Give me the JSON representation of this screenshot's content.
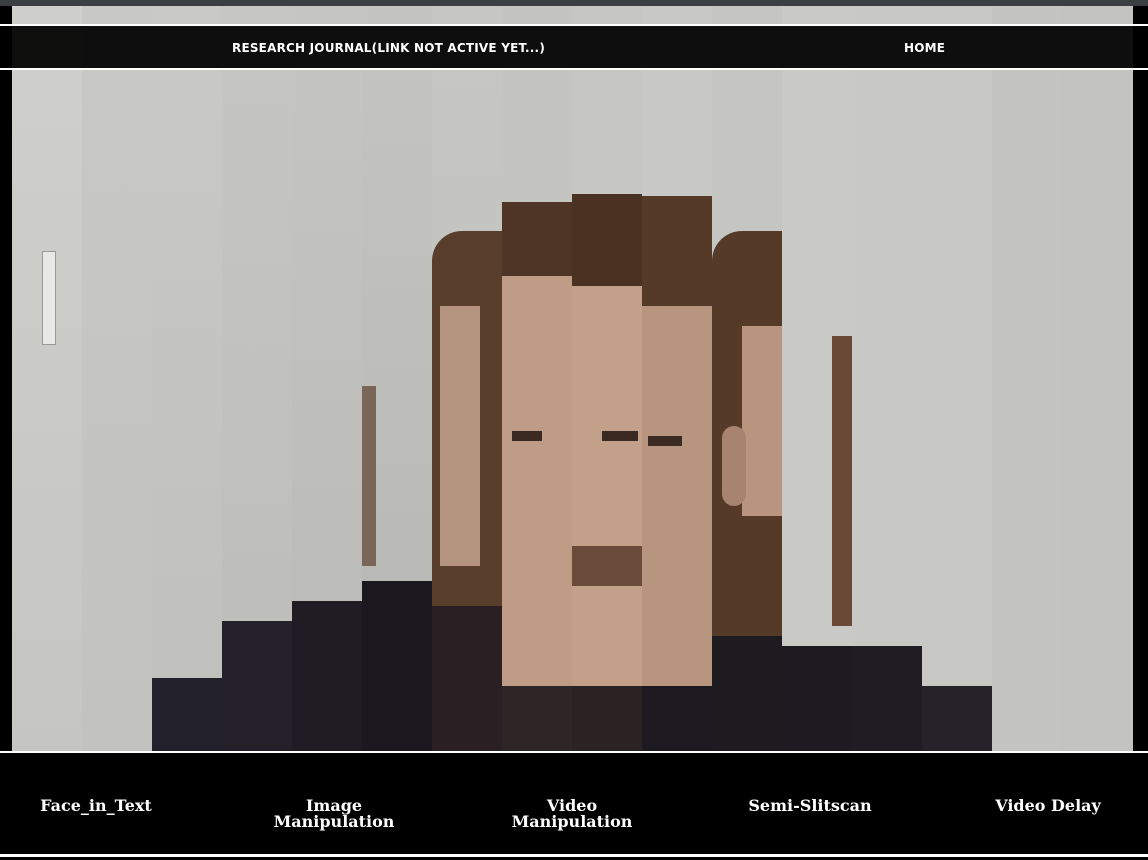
{
  "nav": {
    "journal_label": "RESEARCH JOURNAL(LINK NOT ACTIVE YET...)",
    "home_label": "HOME"
  },
  "projects": [
    {
      "line1": "Face_in_Text",
      "line2": ""
    },
    {
      "line1": "Image",
      "line2": "Manipulation"
    },
    {
      "line1": "Video",
      "line2": "Manipulation"
    },
    {
      "line1": "Semi-Slitscan",
      "line2": ""
    },
    {
      "line1": "Video Delay",
      "line2": ""
    }
  ],
  "colors": {
    "wall": "#c9c9c5",
    "skin": "#b99883",
    "hair": "#4e3526",
    "sweater": "#1e1a22",
    "navbar_bg": "#000000",
    "text": "#ffffff"
  },
  "background": {
    "description_icon": "slitscan-webcam-face-image"
  }
}
